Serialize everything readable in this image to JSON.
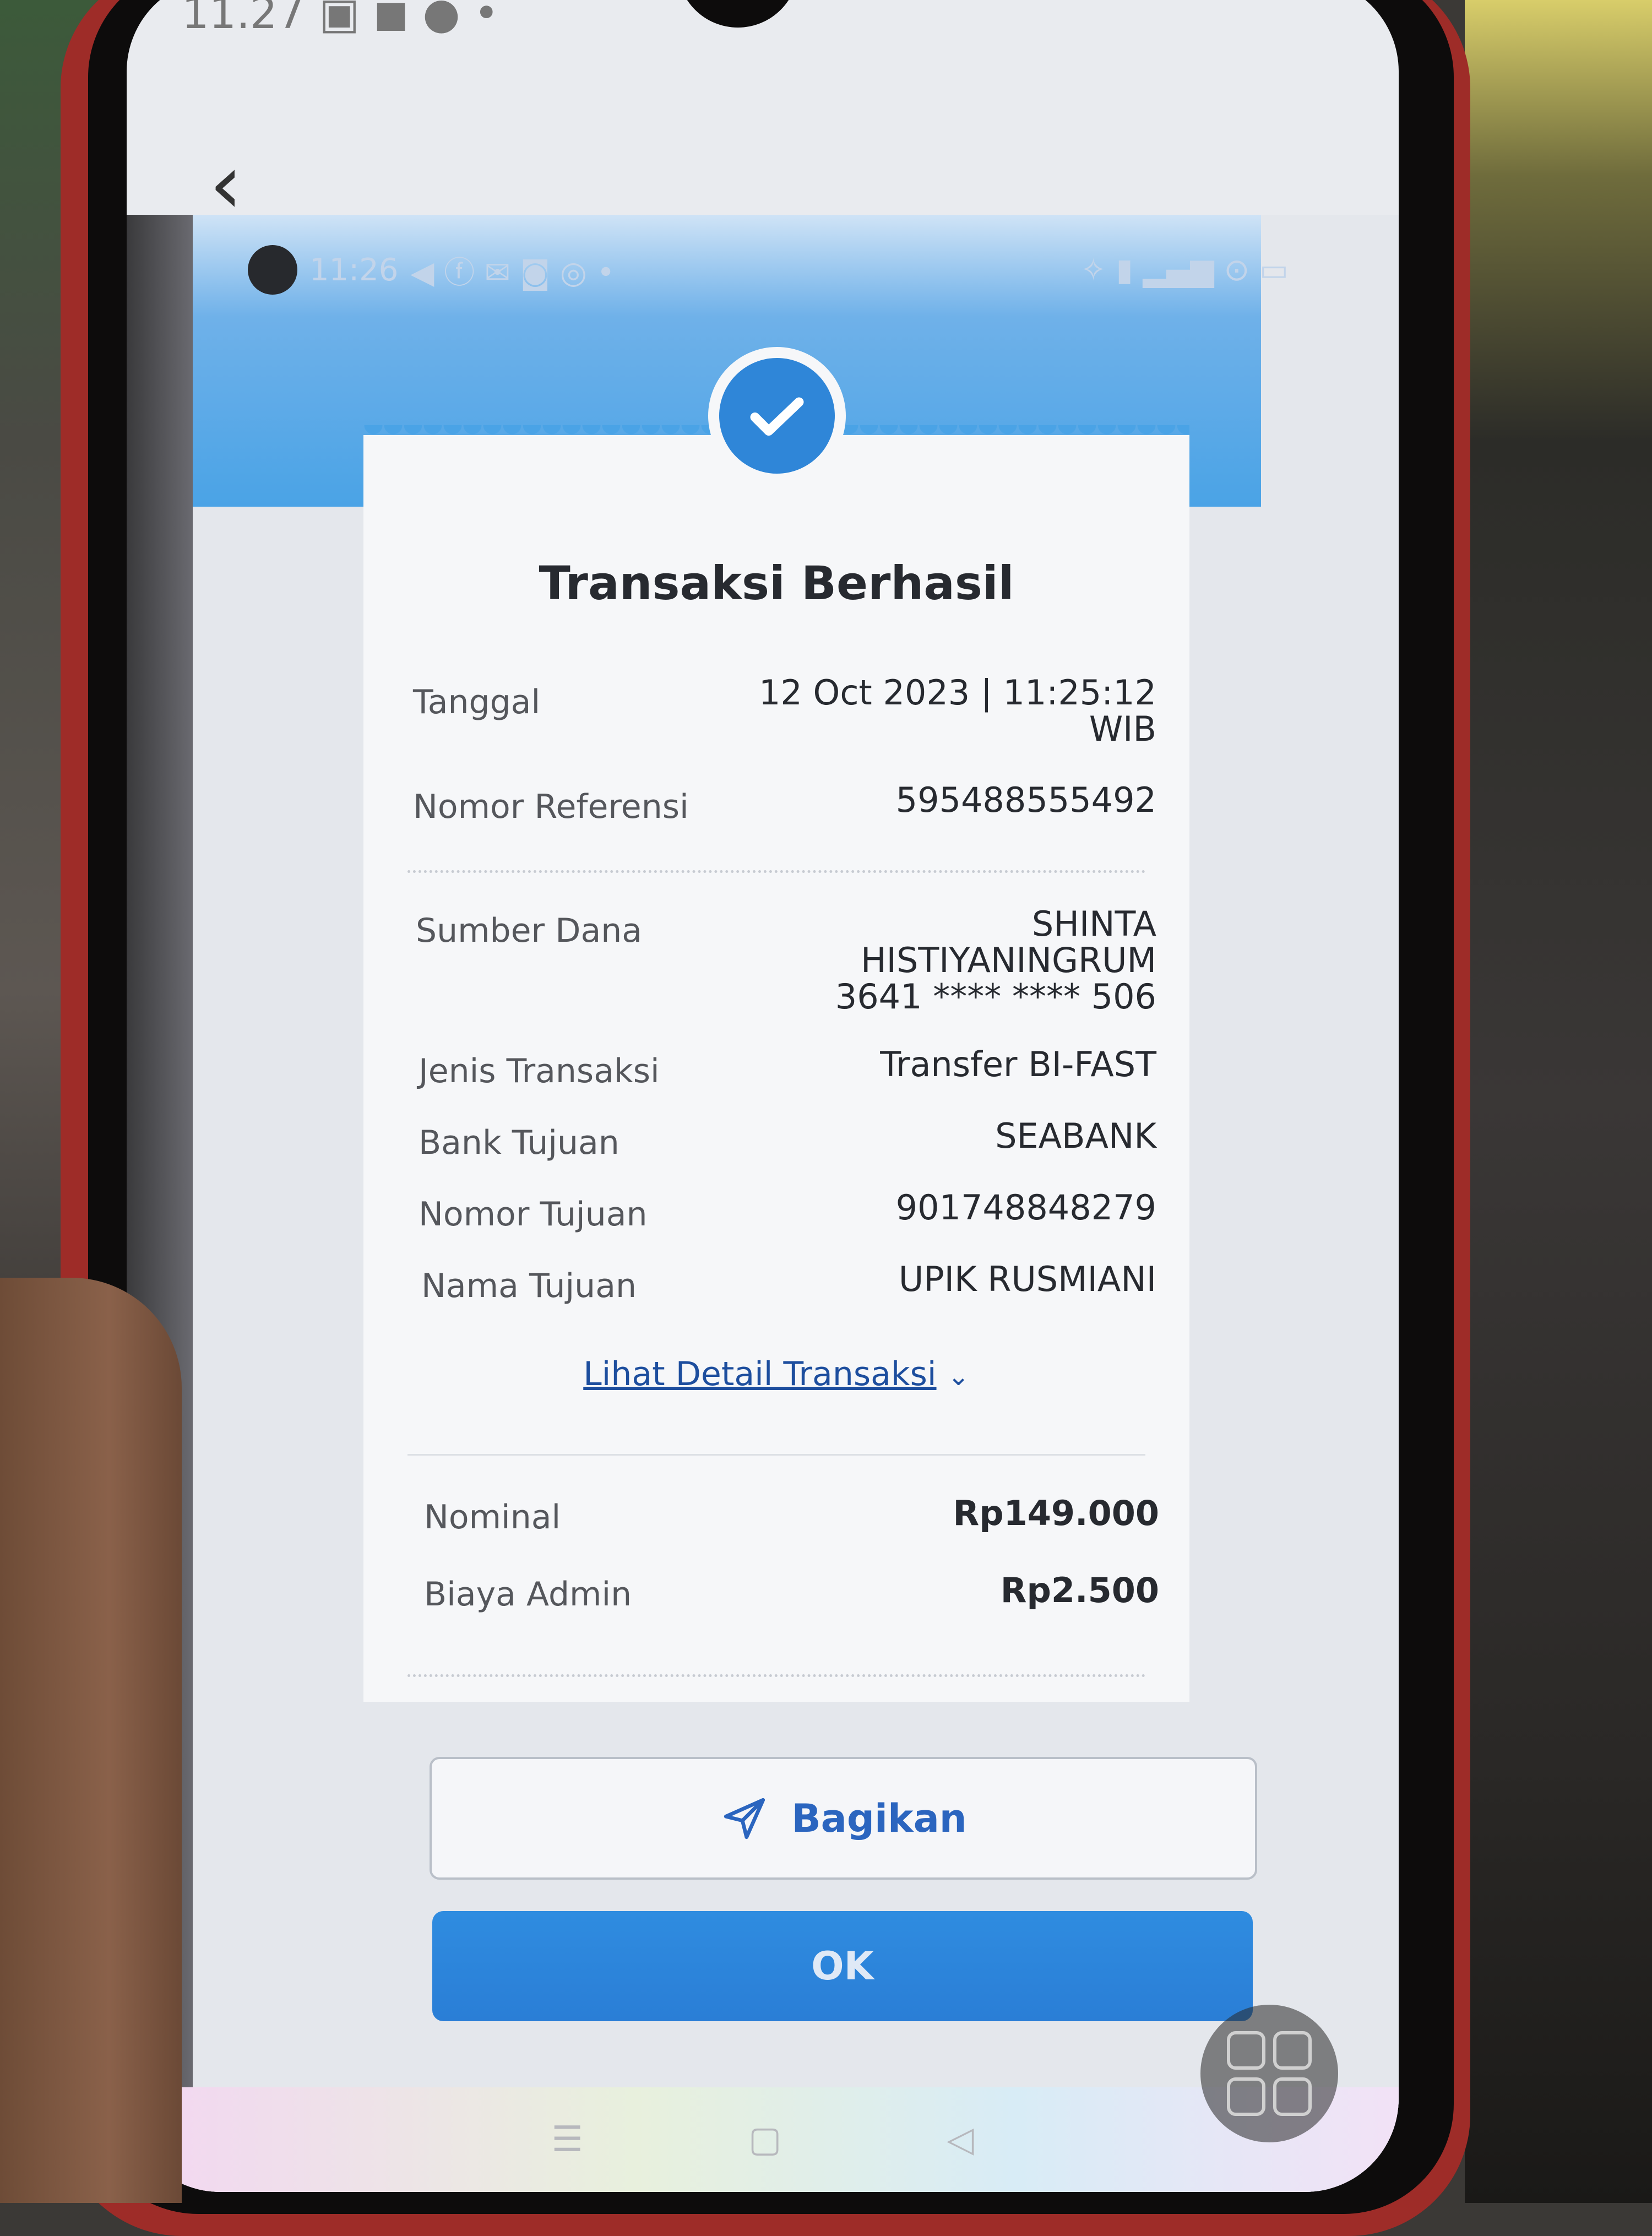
{
  "outer_status": {
    "time": "11.27"
  },
  "inner_status": {
    "time": "11:26"
  },
  "receipt": {
    "title": "Transaksi Berhasil",
    "rows": [
      {
        "label": "Tanggal",
        "value_line1": "12 Oct 2023 | 11:25:12",
        "value_line2": "WIB"
      },
      {
        "label": "Nomor Referensi",
        "value": "595488555492"
      },
      {
        "label": "Sumber Dana",
        "value_line1": "SHINTA",
        "value_line2": "HISTIYANINGRUM",
        "value_line3": "3641 **** **** 506"
      },
      {
        "label": "Jenis Transaksi",
        "value": "Transfer BI-FAST"
      },
      {
        "label": "Bank Tujuan",
        "value": "SEABANK"
      },
      {
        "label": "Nomor Tujuan",
        "value": "901748848279"
      },
      {
        "label": "Nama Tujuan",
        "value": "UPIK RUSMIANI"
      }
    ],
    "detail_link": "Lihat Detail Transaksi",
    "amounts": [
      {
        "label": "Nominal",
        "value": "Rp149.000"
      },
      {
        "label": "Biaya Admin",
        "value": "Rp2.500"
      }
    ]
  },
  "buttons": {
    "share_label": "Bagikan",
    "ok_label": "OK"
  },
  "colors": {
    "primary": "#2f86d8",
    "link": "#1d4e9e",
    "header_blue": "#4aa3e6"
  },
  "icons": [
    "back-chevron-icon",
    "check-icon",
    "share-send-icon",
    "chevron-down-icon"
  ]
}
